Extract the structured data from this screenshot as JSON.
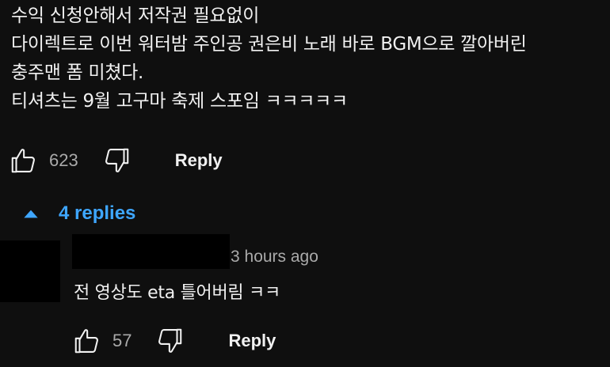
{
  "comment": {
    "lines": [
      "수익 신청안해서 저작권 필요없이",
      "다이렉트로 이번 워터밤 주인공 권은비 노래 바로 BGM으로 깔아버린",
      "충주맨 폼 미쳤다.",
      "티셔츠는 9월 고구마 축제 스포임 ㅋㅋㅋㅋㅋ"
    ],
    "like_icon": "thumbs-up-icon",
    "like_count": "623",
    "dislike_icon": "thumbs-down-icon",
    "reply_label": "Reply"
  },
  "replies_toggle": {
    "icon": "caret-up-icon",
    "label": "4 replies",
    "color": "#3ea6ff"
  },
  "reply": {
    "timestamp": "3 hours ago",
    "text": "전 영상도 eta 틀어버림 ㅋㅋ",
    "like_count": "57",
    "reply_label": "Reply"
  },
  "colors": {
    "background": "#0f0f0f",
    "text": "#f1f1f1",
    "secondary_text": "#aaaaaa",
    "accent": "#3ea6ff"
  }
}
